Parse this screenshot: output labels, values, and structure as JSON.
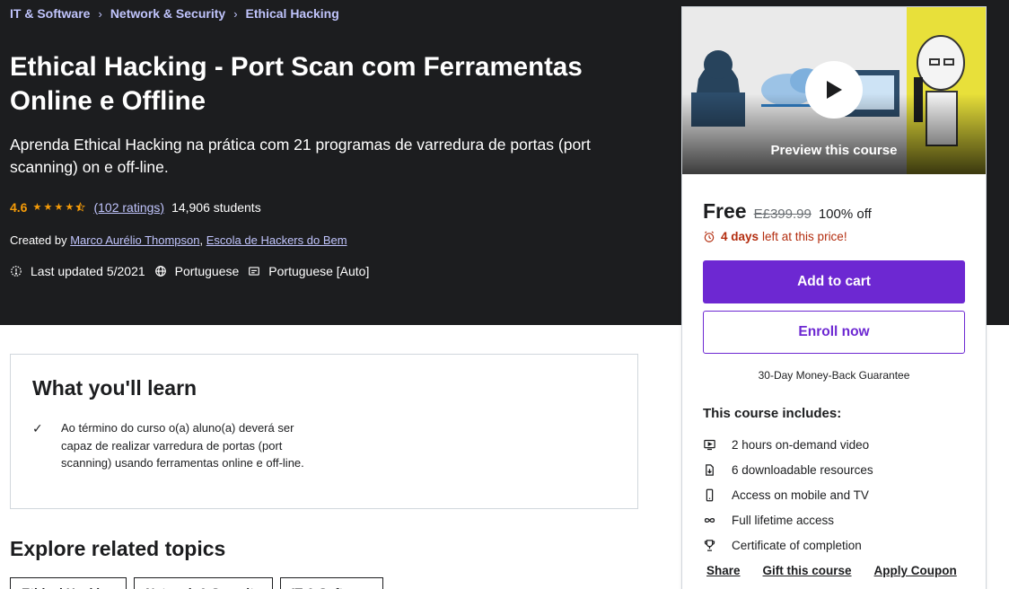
{
  "breadcrumb": [
    "IT & Software",
    "Network & Security",
    "Ethical Hacking"
  ],
  "course": {
    "title": "Ethical Hacking - Port Scan com Ferramentas Online e Offline",
    "subtitle": "Aprenda Ethical Hacking na prática com 21 programas de varredura de portas (port scanning) on e off-line.",
    "rating": "4.6",
    "rating_value": 4.6,
    "rating_max": 5,
    "ratings_count": "(102 ratings)",
    "students": "14,906 students",
    "created_by_label": "Created by",
    "authors": [
      "Marco Aurélio Thompson",
      "Escola de Hackers do Bem"
    ],
    "author_separator": ",",
    "last_updated": "Last updated 5/2021",
    "language": "Portuguese",
    "captions": "Portuguese [Auto]"
  },
  "learn": {
    "title": "What you'll learn",
    "items": [
      "Ao término do curso o(a) aluno(a) deverá ser capaz de realizar varredura de portas (port scanning) usando ferramentas online e off-line."
    ]
  },
  "explore": {
    "title": "Explore related topics",
    "topics": [
      "Ethical Hacking",
      "Network & Security",
      "IT & Software"
    ]
  },
  "card": {
    "preview_label": "Preview this course",
    "price": "Free",
    "original_price": "E£399.99",
    "discount": "100% off",
    "timer_bold": "4 days",
    "timer_rest": "left at this price!",
    "add_to_cart": "Add to cart",
    "enroll_now": "Enroll now",
    "guarantee": "30-Day Money-Back Guarantee",
    "includes_title": "This course includes:",
    "includes": [
      {
        "icon": "video-icon",
        "label": "2 hours on-demand video"
      },
      {
        "icon": "file-download-icon",
        "label": "6 downloadable resources"
      },
      {
        "icon": "mobile-icon",
        "label": "Access on mobile and TV"
      },
      {
        "icon": "infinity-icon",
        "label": "Full lifetime access"
      },
      {
        "icon": "trophy-icon",
        "label": "Certificate of completion"
      }
    ],
    "links": [
      "Share",
      "Gift this course",
      "Apply Coupon"
    ]
  },
  "colors": {
    "hero_bg": "#1c1d1f",
    "link_purple": "#c0c4fc",
    "star": "#f69c08",
    "primary": "#6d28d2",
    "timer_red": "#b32d0f"
  }
}
